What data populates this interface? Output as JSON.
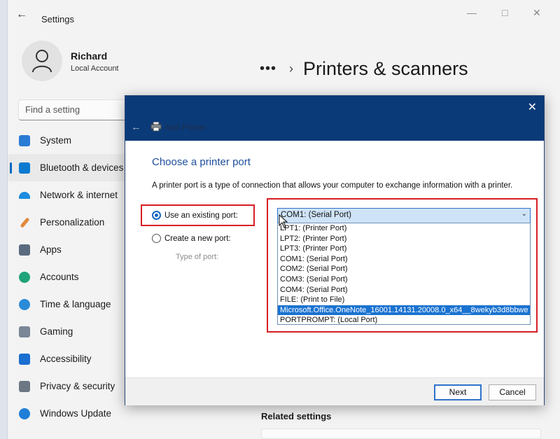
{
  "settings": {
    "app_title": "Settings",
    "user": {
      "name": "Richard",
      "type": "Local Account"
    },
    "search_placeholder": "Find a setting",
    "breadcrumb_more": "•••",
    "page_title": "Printers & scanners",
    "related_settings": "Related settings",
    "nav": [
      {
        "label": "System",
        "icon": "system-icon",
        "color": "#2b7bd6"
      },
      {
        "label": "Bluetooth & devices",
        "icon": "bluetooth-icon",
        "color": "#0a7ad1"
      },
      {
        "label": "Network & internet",
        "icon": "wifi-icon",
        "color": "#1c8be0"
      },
      {
        "label": "Personalization",
        "icon": "brush-icon",
        "color": "#e08a3c"
      },
      {
        "label": "Apps",
        "icon": "apps-icon",
        "color": "#5a6b80"
      },
      {
        "label": "Accounts",
        "icon": "accounts-icon",
        "color": "#1fa37a"
      },
      {
        "label": "Time & language",
        "icon": "globe-clock-icon",
        "color": "#2a8bd8"
      },
      {
        "label": "Gaming",
        "icon": "gamepad-icon",
        "color": "#7a8797"
      },
      {
        "label": "Accessibility",
        "icon": "accessibility-icon",
        "color": "#1a6fd0"
      },
      {
        "label": "Privacy & security",
        "icon": "shield-icon",
        "color": "#6d7784"
      },
      {
        "label": "Windows Update",
        "icon": "update-icon",
        "color": "#1f7fd6"
      }
    ]
  },
  "dialog": {
    "title": "Add Printer",
    "heading": "Choose a printer port",
    "description": "A printer port is a type of connection that allows your computer to exchange information with a printer.",
    "radio_existing": "Use an existing port:",
    "radio_new": "Create a new port:",
    "type_of_port": "Type of port:",
    "selected_port": "COM1: (Serial Port)",
    "ports": [
      "LPT1: (Printer Port)",
      "LPT2: (Printer Port)",
      "LPT3: (Printer Port)",
      "COM1: (Serial Port)",
      "COM2: (Serial Port)",
      "COM3: (Serial Port)",
      "COM4: (Serial Port)",
      "FILE: (Print to File)",
      "Microsoft.Office.OneNote_16001.14131.20008.0_x64__8wekyb3d8bbwe",
      "PORTPROMPT: (Local Port)"
    ],
    "highlighted_port": "Microsoft.Office.OneNote_16001.14131.20008.0_x64__8wekyb3d8bbwe",
    "next_label": "Next",
    "cancel_label": "Cancel"
  },
  "colors": {
    "accent": "#0067c0",
    "dialog_header": "#0b3a78",
    "annotation": "#d61f26",
    "selection": "#1a73d1"
  }
}
